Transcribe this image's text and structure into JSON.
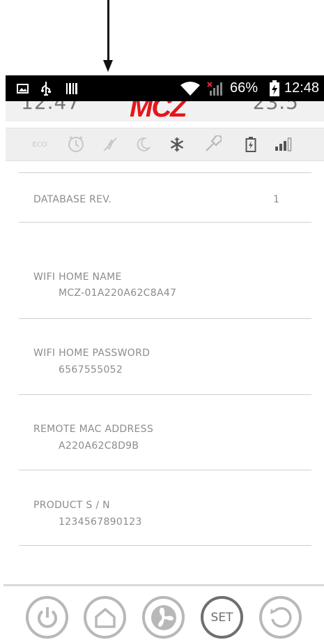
{
  "status_bar": {
    "battery_percent": "66%",
    "time": "12:48",
    "icons": [
      "picture-icon",
      "usb-icon",
      "barcode-icon",
      "wifi-icon",
      "signal-no-sim-icon",
      "battery-charging-icon"
    ]
  },
  "header": {
    "left_value": "12.47",
    "logo": "MCZ",
    "right_value": "23.5"
  },
  "icon_bar": {
    "eco_label": "ECO",
    "icons": [
      "eco-icon",
      "clock-icon",
      "mute-icon",
      "moon-icon",
      "snowflake-icon",
      "wrench-icon",
      "battery-icon",
      "signal-bars-icon"
    ]
  },
  "settings": {
    "database_rev_label": "DATABASE REV.",
    "database_rev_value": "1",
    "wifi_home_name_label": "WIFI HOME NAME",
    "wifi_home_name_value": "MCZ-01A220A62C8A47",
    "wifi_home_password_label": "WIFI HOME PASSWORD",
    "wifi_home_password_value": "6567555052",
    "remote_mac_label": "REMOTE MAC ADDRESS",
    "remote_mac_value": "A220A62C8D9B",
    "product_sn_label": "PRODUCT S / N",
    "product_sn_value": "1234567890123"
  },
  "bottom_nav": {
    "set_label": "SET",
    "icons": [
      "power-icon",
      "home-icon",
      "fan-icon",
      "set-icon",
      "refresh-icon"
    ]
  },
  "colors": {
    "logo_red": "#e4161b",
    "text_gray": "#8c8c8c",
    "status_black": "#000000"
  }
}
